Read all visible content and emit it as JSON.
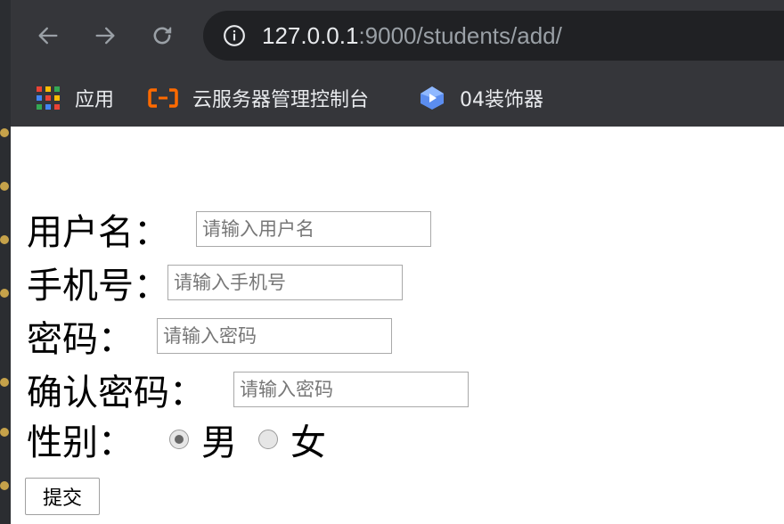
{
  "browser": {
    "url_host": "127.0.0.1",
    "url_rest": ":9000/students/add/",
    "bookmarks": [
      {
        "label": "应用",
        "icon": "apps-grid-icon"
      },
      {
        "label": "云服务器管理控制台",
        "icon": "aliyun-icon"
      },
      {
        "label": "04装饰器",
        "icon": "gem-icon"
      }
    ]
  },
  "form": {
    "username": {
      "label": "用户名：",
      "placeholder": "请输入用户名"
    },
    "phone": {
      "label": "手机号：",
      "placeholder": "请输入手机号"
    },
    "password": {
      "label": "密码：",
      "placeholder": "请输入密码"
    },
    "confirm": {
      "label": "确认密码：",
      "placeholder": "请输入密码"
    },
    "gender": {
      "label": "性别：",
      "options": [
        {
          "label": "男",
          "checked": true
        },
        {
          "label": "女",
          "checked": false
        }
      ]
    },
    "submit_label": "提交"
  }
}
